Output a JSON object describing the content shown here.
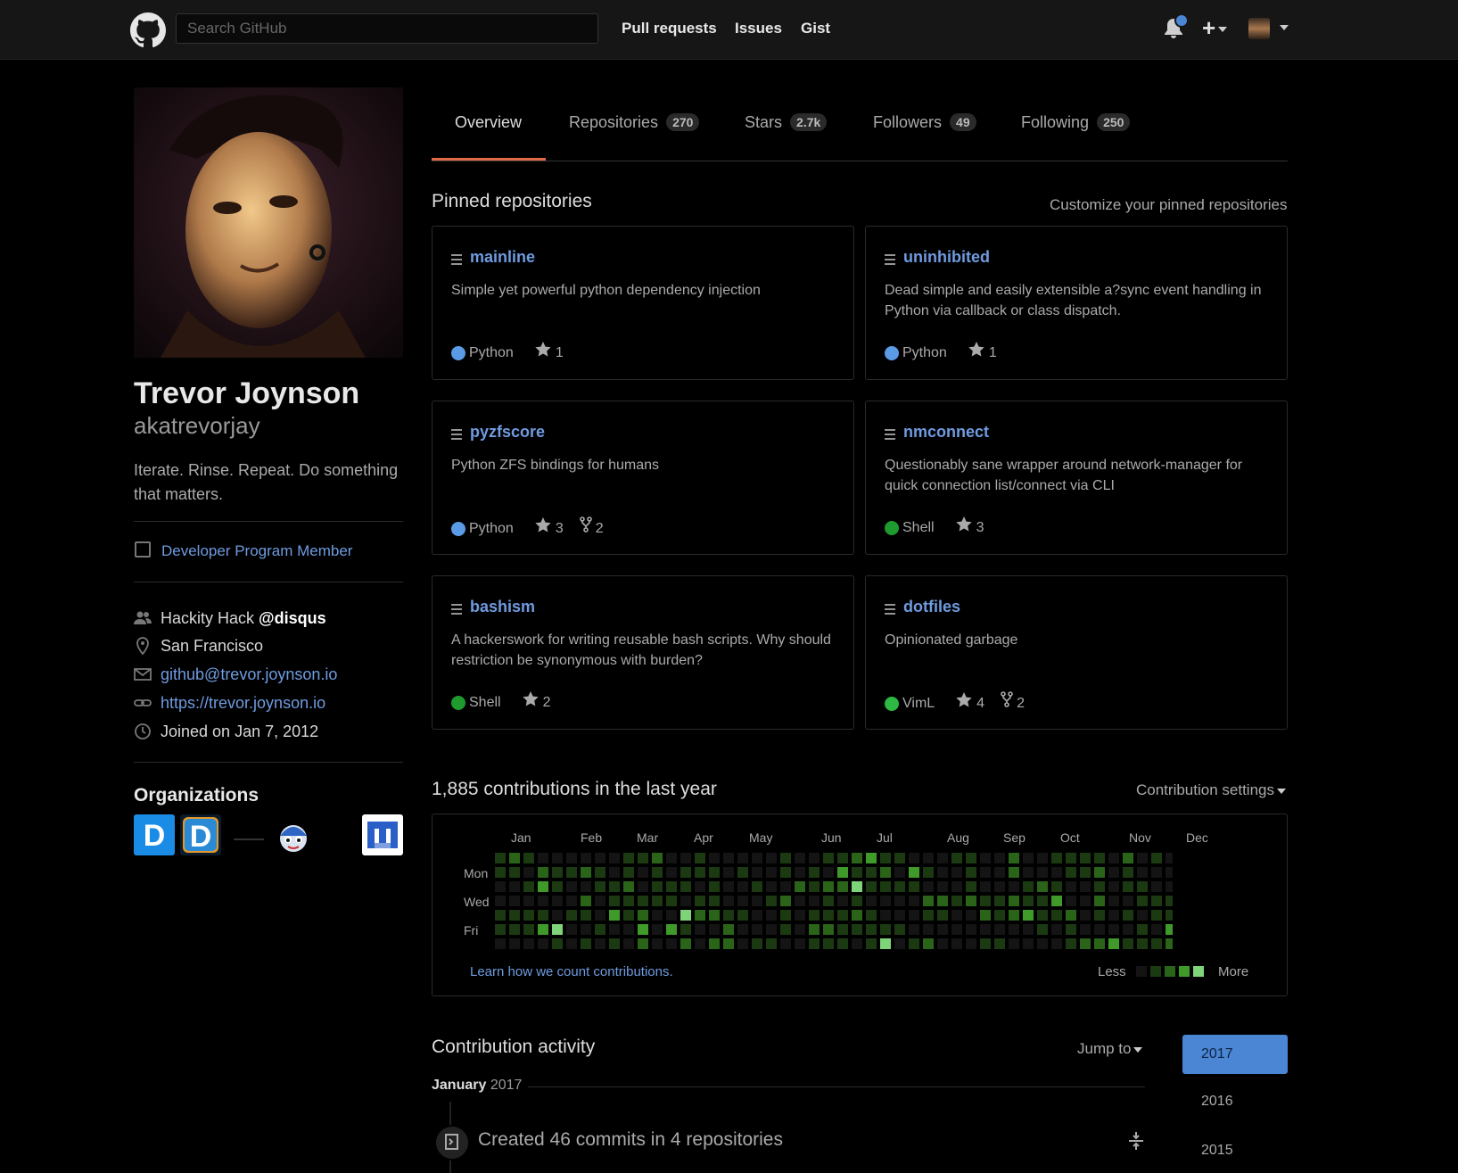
{
  "header": {
    "search_placeholder": "Search GitHub",
    "nav": [
      "Pull requests",
      "Issues",
      "Gist"
    ],
    "plus_label": "+",
    "icons": [
      "github-mark-icon",
      "bell-icon",
      "plus-icon",
      "avatar"
    ]
  },
  "profile": {
    "full_name": "Trevor Joynson",
    "username": "akatrevorjay",
    "bio": "Iterate. Rinse. Repeat. Do something that matters.",
    "developer_program": "Developer Program Member",
    "company_prefix": "Hackity Hack ",
    "company_handle": "@disqus",
    "location": "San Francisco",
    "email": "github@trevor.joynson.io",
    "website": "https://trevor.joynson.io",
    "joined": "Joined on Jan 7, 2012",
    "organizations_title": "Organizations"
  },
  "tabs": [
    {
      "label": "Overview",
      "count": ""
    },
    {
      "label": "Repositories",
      "count": "270"
    },
    {
      "label": "Stars",
      "count": "2.7k"
    },
    {
      "label": "Followers",
      "count": "49"
    },
    {
      "label": "Following",
      "count": "250"
    }
  ],
  "pinned": {
    "title": "Pinned repositories",
    "customize": "Customize your pinned repositories",
    "repos": [
      {
        "name": "mainline",
        "desc": "Simple yet powerful python dependency injection",
        "lang": "Python",
        "lang_color": "#5b9be6",
        "stars": "1",
        "forks": ""
      },
      {
        "name": "uninhibited",
        "desc": "Dead simple and easily extensible a?sync event handling in Python via callback or class dispatch.",
        "lang": "Python",
        "lang_color": "#5b9be6",
        "stars": "1",
        "forks": ""
      },
      {
        "name": "pyzfscore",
        "desc": "Python ZFS bindings for humans",
        "lang": "Python",
        "lang_color": "#5b9be6",
        "stars": "3",
        "forks": "2"
      },
      {
        "name": "nmconnect",
        "desc": "Questionably sane wrapper around network-manager for quick connection list/connect via CLI",
        "lang": "Shell",
        "lang_color": "#1f9a2e",
        "stars": "3",
        "forks": ""
      },
      {
        "name": "bashism",
        "desc": "A hackerswork for writing reusable bash scripts. Why should restriction be synonymous with burden?",
        "lang": "Shell",
        "lang_color": "#1f9a2e",
        "stars": "2",
        "forks": ""
      },
      {
        "name": "dotfiles",
        "desc": "Opinionated garbage",
        "lang": "VimL",
        "lang_color": "#2cb843",
        "stars": "4",
        "forks": "2"
      }
    ]
  },
  "contributions": {
    "title": "1,885 contributions in the last year",
    "settings": "Contribution settings",
    "months": [
      "Jan",
      "Feb",
      "Mar",
      "Apr",
      "May",
      "Jun",
      "Jul",
      "Aug",
      "Sep",
      "Oct",
      "Nov",
      "Dec"
    ],
    "weekdays": [
      "Mon",
      "Wed",
      "Fri"
    ],
    "learn": "Learn how we count contributions.",
    "less": "Less",
    "more": "More",
    "palette": [
      "#141414",
      "#1b3a12",
      "#2a6419",
      "#3f9a2a",
      "#7fd47a"
    ]
  },
  "activity": {
    "title": "Contribution activity",
    "jump_to": "Jump to",
    "years": [
      "2017",
      "2016",
      "2015"
    ],
    "month": "January",
    "month_year": "2017",
    "item": "Created 46 commits in 4 repositories"
  }
}
